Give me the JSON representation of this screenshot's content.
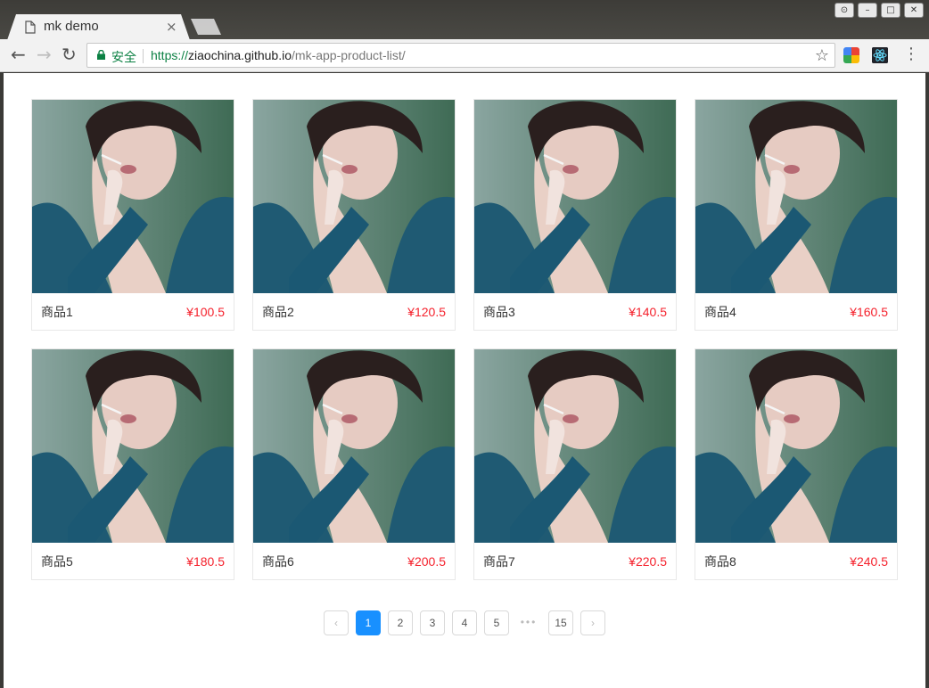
{
  "browser": {
    "tab_title": "mk demo",
    "tab_close": "×",
    "secure_label": "安全",
    "url_scheme": "https://",
    "url_host": "ziaochina.github.io",
    "url_path": "/mk-app-product-list/",
    "window_controls": [
      "⊙",
      "–",
      "□",
      "✕"
    ]
  },
  "colors": {
    "price": "#f5222d",
    "active_page": "#1890ff",
    "secure": "#0b8043"
  },
  "products": [
    {
      "name": "商品1",
      "price": "¥100.5"
    },
    {
      "name": "商品2",
      "price": "¥120.5"
    },
    {
      "name": "商品3",
      "price": "¥140.5"
    },
    {
      "name": "商品4",
      "price": "¥160.5"
    },
    {
      "name": "商品5",
      "price": "¥180.5"
    },
    {
      "name": "商品6",
      "price": "¥200.5"
    },
    {
      "name": "商品7",
      "price": "¥220.5"
    },
    {
      "name": "商品8",
      "price": "¥240.5"
    }
  ],
  "pagination": {
    "prev": "‹",
    "next": "›",
    "pages": [
      "1",
      "2",
      "3",
      "4",
      "5"
    ],
    "ellipsis": "•••",
    "last": "15",
    "current": "1"
  }
}
